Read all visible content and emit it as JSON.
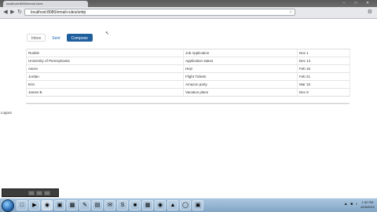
{
  "browser": {
    "tab_title": "localhost:8080/email-rules",
    "address": "localhost:8080/email-rules/smtp",
    "back_icon": "arrow-left-icon",
    "forward_icon": "arrow-right-icon",
    "reload_icon": "reload-icon",
    "star_icon": "star-icon",
    "menu_icon": "wrench-icon"
  },
  "mail": {
    "tabs": [
      {
        "label": "Inbox"
      },
      {
        "label": "Sent"
      },
      {
        "label": "Compose"
      }
    ],
    "rows": [
      {
        "from": "Runkle",
        "subject": "Job Application",
        "date": "Nov 1"
      },
      {
        "from": "University of Pennsylvania",
        "subject": "Application status",
        "date": "Dec 12"
      },
      {
        "from": "Aaron",
        "subject": "Hey!",
        "date": "Feb 15"
      },
      {
        "from": "Jordan",
        "subject": "Flight Tickets",
        "date": "Feb 21"
      },
      {
        "from": "Erin",
        "subject": "Amazon party",
        "date": "Mar 15"
      },
      {
        "from": "James B",
        "subject": "Vacation plans",
        "date": "Dec 8"
      }
    ]
  },
  "logout_label": "Logout",
  "taskbar": {
    "time": "1:32 PM",
    "date": "4/15/2012"
  },
  "colors": {
    "accent": "#1f5f9e",
    "link": "#1a66b3"
  }
}
